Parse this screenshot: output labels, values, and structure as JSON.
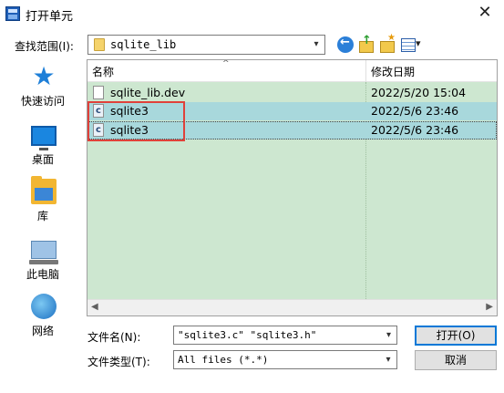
{
  "window": {
    "title": "打开单元",
    "close_glyph": "✕"
  },
  "lookin": {
    "label": "查找范围(I):",
    "value": "sqlite_lib",
    "arrow": "▾"
  },
  "places": [
    {
      "label": "快速访问",
      "icon": "star-icon"
    },
    {
      "label": "桌面",
      "icon": "desktop-icon"
    },
    {
      "label": "库",
      "icon": "library-icon"
    },
    {
      "label": "此电脑",
      "icon": "pc-icon"
    },
    {
      "label": "网络",
      "icon": "network-icon"
    }
  ],
  "file_list": {
    "columns": {
      "name": "名称",
      "date": "修改日期"
    },
    "sort_glyph": "^",
    "rows": [
      {
        "name": "sqlite_lib.dev",
        "date": "2022/5/20 15:04",
        "icon": "document-icon"
      },
      {
        "name": "sqlite3",
        "date": "2022/5/6 23:46",
        "icon": "c-source-icon",
        "icon_glyph": "c"
      },
      {
        "name": "sqlite3",
        "date": "2022/5/6 23:46",
        "icon": "c-source-icon",
        "icon_glyph": "c"
      }
    ],
    "scroll_left": "◀",
    "scroll_right": "▶"
  },
  "filename": {
    "label": "文件名(N):",
    "value": "\"sqlite3.c\" \"sqlite3.h\"",
    "arrow": "▾"
  },
  "filetype": {
    "label": "文件类型(T):",
    "value": "All files (*.*)",
    "arrow": "▾"
  },
  "buttons": {
    "open": "打开(O)",
    "cancel": "取消"
  },
  "colors": {
    "list_bg": "#cde7d0",
    "selection": "#a8d8dc",
    "highlight_box": "#e0413a",
    "primary_border": "#0078d7"
  }
}
